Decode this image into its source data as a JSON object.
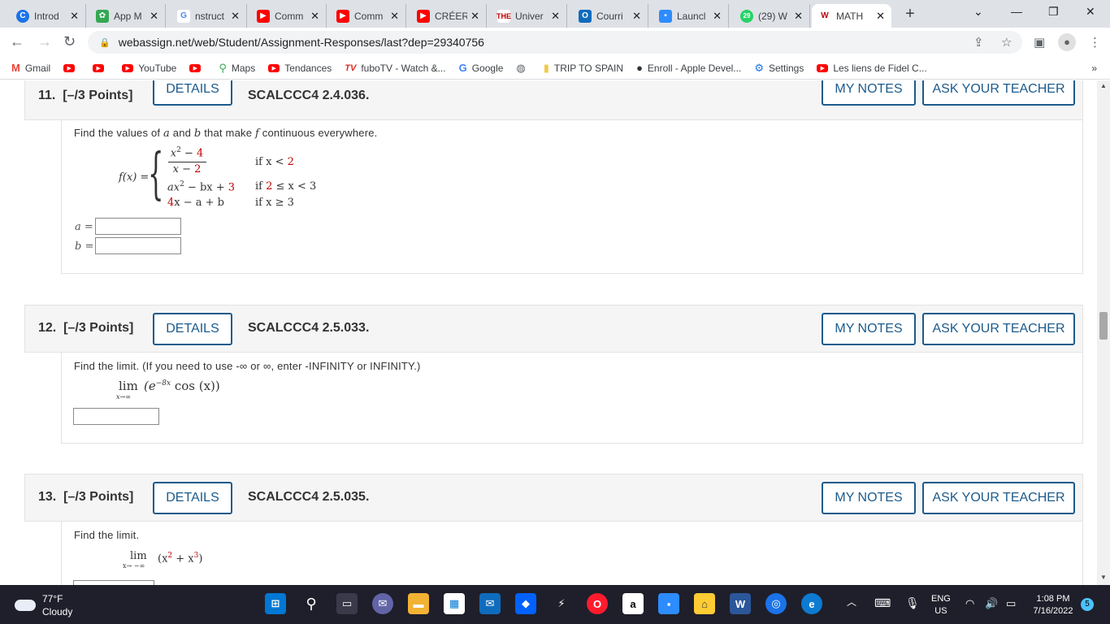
{
  "browser": {
    "tabs": [
      {
        "label": "Introd",
        "icon": "chrome-icon",
        "color": "#1a73e8"
      },
      {
        "label": "App M",
        "icon": "app-icon",
        "color": "#34a853"
      },
      {
        "label": "nstruct",
        "icon": "google-icon",
        "color": "#4285f4"
      },
      {
        "label": "Comm",
        "icon": "youtube-icon",
        "color": "#ff0000"
      },
      {
        "label": "Comm",
        "icon": "youtube-icon",
        "color": "#ff0000"
      },
      {
        "label": "CRÉER",
        "icon": "youtube-icon",
        "color": "#ff0000"
      },
      {
        "label": "Univer",
        "icon": "the-icon",
        "color": "#c00000"
      },
      {
        "label": "Courri",
        "icon": "outlook-icon",
        "color": "#0f6cbd"
      },
      {
        "label": "Launcl",
        "icon": "zoom-icon",
        "color": "#2d8cff"
      },
      {
        "label": "(29) W",
        "icon": "whatsapp-icon",
        "color": "#25d366"
      },
      {
        "label": "MATH",
        "icon": "webassign-icon",
        "color": "#c00000"
      }
    ],
    "url": "webassign.net/web/Student/Assignment-Responses/last?dep=29340756",
    "bookmarks": [
      {
        "label": "Gmail",
        "icon": "gmail-icon"
      },
      {
        "label": "",
        "icon": "youtube-icon"
      },
      {
        "label": "",
        "icon": "youtube-icon"
      },
      {
        "label": "YouTube",
        "icon": "youtube-icon"
      },
      {
        "label": "",
        "icon": "youtube-icon"
      },
      {
        "label": "Maps",
        "icon": "maps-icon"
      },
      {
        "label": "Tendances",
        "icon": "youtube-icon"
      },
      {
        "label": "fuboTV - Watch &...",
        "icon": "fubo-icon"
      },
      {
        "label": "Google",
        "icon": "google-icon"
      },
      {
        "label": "",
        "icon": "globe-icon"
      },
      {
        "label": "TRIP TO SPAIN",
        "icon": "folder-icon"
      },
      {
        "label": "Enroll - Apple Devel...",
        "icon": "apple-icon"
      },
      {
        "label": "Settings",
        "icon": "gear-icon"
      },
      {
        "label": "Les liens de Fidel C...",
        "icon": "youtube-icon"
      }
    ],
    "more": "»"
  },
  "questions": [
    {
      "number": "11.",
      "points": "[–/3 Points]",
      "details": "DETAILS",
      "code": "SCALCCC4 2.4.036.",
      "my_notes": "MY NOTES",
      "ask": "ASK YOUR TEACHER",
      "prompt_pre": "Find the values of ",
      "prompt_a": "a",
      "prompt_mid": " and ",
      "prompt_b": "b",
      "prompt_mid2": " that make ",
      "prompt_f": "f",
      "prompt_post": " continuous everywhere.",
      "fx": "f(x) =",
      "piece1_num_a": "x",
      "piece1_num_exp": "2",
      "piece1_num_b": " − ",
      "piece1_num_c": "4",
      "piece1_den_a": "x − ",
      "piece1_den_b": "2",
      "piece1_cond_a": "if x < ",
      "piece1_cond_b": "2",
      "piece2_a": "ax",
      "piece2_exp": "2",
      "piece2_b": " − bx + ",
      "piece2_c": "3",
      "piece2_cond_a": "if ",
      "piece2_cond_b": "2",
      "piece2_cond_c": " ≤ x < 3",
      "piece3_a": "4",
      "piece3_b": "x − a + b",
      "piece3_cond": "if x ≥ 3",
      "label_a": "a =",
      "label_b": "b ="
    },
    {
      "number": "12.",
      "points": "[–/3 Points]",
      "details": "DETAILS",
      "code": "SCALCCC4 2.5.033.",
      "my_notes": "MY NOTES",
      "ask": "ASK YOUR TEACHER",
      "prompt": "Find the limit. (If you need to use -∞ or ∞, enter -INFINITY or INFINITY.)",
      "lim": "lim",
      "lim_sub": "x→∞",
      "expr_a": "(e",
      "expr_exp": "−8x",
      "expr_b": " cos (x))"
    },
    {
      "number": "13.",
      "points": "[–/3 Points]",
      "details": "DETAILS",
      "code": "SCALCCC4 2.5.035.",
      "my_notes": "MY NOTES",
      "ask": "ASK YOUR TEACHER",
      "prompt": "Find the limit.",
      "lim": "lim",
      "lim_sub": "x→ −∞",
      "expr_a": "(x",
      "expr_exp1": "2",
      "expr_b": " + x",
      "expr_exp2": "3",
      "expr_c": ")"
    }
  ],
  "taskbar": {
    "temp": "77°F",
    "condition": "Cloudy",
    "lang": "ENG",
    "region": "US",
    "time": "1:08 PM",
    "date": "7/16/2022",
    "notifications": "5"
  }
}
